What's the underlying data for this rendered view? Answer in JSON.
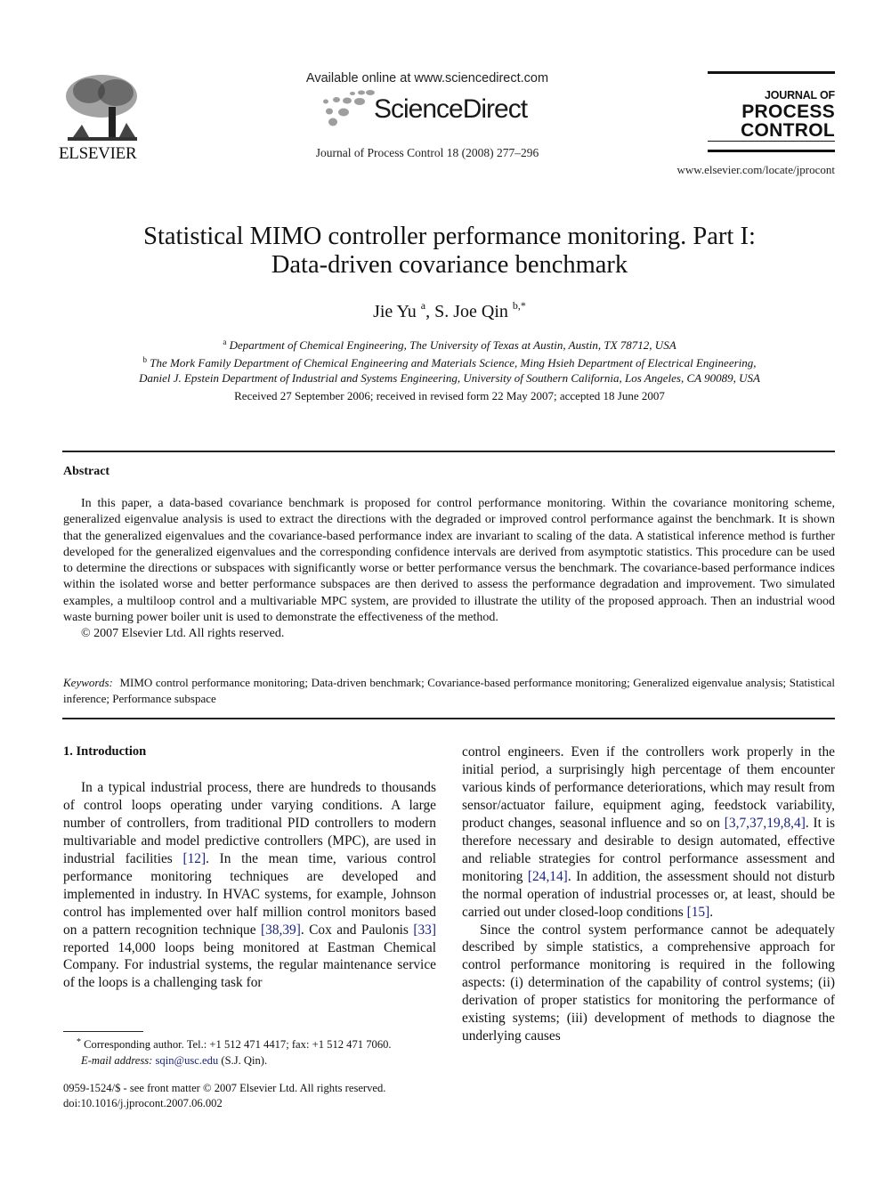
{
  "header": {
    "publisher": "ELSEVIER",
    "available_online": "Available online at www.sciencedirect.com",
    "sciencedirect_brand": "ScienceDirect",
    "journal_citation": "Journal of Process Control 18 (2008) 277–296",
    "journal_logo": {
      "line1": "JOURNAL OF",
      "line2": "PROCESS",
      "line3": "CONTROL"
    },
    "journal_url": "www.elsevier.com/locate/jprocont"
  },
  "article": {
    "title_line1": "Statistical MIMO controller performance monitoring. Part I:",
    "title_line2": "Data-driven covariance benchmark",
    "authors": [
      {
        "name": "Jie Yu",
        "sup": "a"
      },
      {
        "name": "S. Joe Qin",
        "sup": "b,*"
      }
    ],
    "author_separator": ", ",
    "affiliations": [
      {
        "sup": "a",
        "text": "Department of Chemical Engineering, The University of Texas at Austin, Austin, TX 78712, USA"
      },
      {
        "sup": "b",
        "text": "The Mork Family Department of Chemical Engineering and Materials Science, Ming Hsieh Department of Electrical Engineering,"
      },
      {
        "sup": "",
        "text": "Daniel J. Epstein Department of Industrial and Systems Engineering, University of Southern California, Los Angeles, CA 90089, USA"
      }
    ],
    "received": "Received 27 September 2006; received in revised form 22 May 2007; accepted 18 June 2007"
  },
  "abstract": {
    "heading": "Abstract",
    "text": "In this paper, a data-based covariance benchmark is proposed for control performance monitoring. Within the covariance monitoring scheme, generalized eigenvalue analysis is used to extract the directions with the degraded or improved control performance against the benchmark. It is shown that the generalized eigenvalues and the covariance-based performance index are invariant to scaling of the data. A statistical inference method is further developed for the generalized eigenvalues and the corresponding confidence intervals are derived from asymptotic statistics. This procedure can be used to determine the directions or subspaces with significantly worse or better performance versus the benchmark. The covariance-based performance indices within the isolated worse and better performance subspaces are then derived to assess the performance degradation and improvement. Two simulated examples, a multiloop control and a multivariable MPC system, are provided to illustrate the utility of the proposed approach. Then an industrial wood waste burning power boiler unit is used to demonstrate the effectiveness of the method.",
    "copyright": "© 2007 Elsevier Ltd. All rights reserved."
  },
  "keywords": {
    "label": "Keywords:",
    "text": "MIMO control performance monitoring; Data-driven benchmark; Covariance-based performance monitoring; Generalized eigenvalue analysis; Statistical inference; Performance subspace"
  },
  "introduction": {
    "heading": "1. Introduction",
    "left_col": {
      "p1_a": "In a typical industrial process, there are hundreds to thousands of control loops operating under varying conditions. A large number of controllers, from traditional PID controllers to modern multivariable and model predictive controllers (MPC), are used in industrial facilities ",
      "ref1": "[12]",
      "p1_b": ". In the mean time, various control performance monitoring techniques are developed and implemented in industry. In HVAC systems, for example, Johnson control has implemented over half million control monitors based on a pattern recognition technique ",
      "ref2": "[38,39]",
      "p1_c": ". Cox and Paulonis ",
      "ref3": "[33]",
      "p1_d": " reported 14,000 loops being monitored at Eastman Chemical Company. For industrial systems, the regular maintenance service of the loops is a challenging task for"
    },
    "right_col": {
      "p1_a": "control engineers. Even if the controllers work properly in the initial period, a surprisingly high percentage of them encounter various kinds of performance deteriorations, which may result from sensor/actuator failure, equipment aging, feedstock variability, product changes, seasonal influence and so on ",
      "ref1": "[3,7,37,19,8,4]",
      "p1_b": ". It is therefore necessary and desirable to design automated, effective and reliable strategies for control performance assessment and monitoring ",
      "ref2": "[24,14]",
      "p1_c": ". In addition, the assessment should not disturb the normal operation of industrial processes or, at least, should be carried out under closed-loop conditions ",
      "ref3": "[15]",
      "p1_d": ".",
      "p2": "Since the control system performance cannot be adequately described by simple statistics, a comprehensive approach for control performance monitoring is required in the following aspects: (i) determination of the capability of control systems; (ii) derivation of proper statistics for monitoring the performance of existing systems; (iii) development of methods to diagnose the underlying causes"
    }
  },
  "footnote": {
    "marker": "*",
    "corresponding": "Corresponding author. Tel.: +1 512 471 4417; fax: +1 512 471 7060.",
    "email_label": "E-mail address:",
    "email": "sqin@usc.edu",
    "email_owner": "(S.J. Qin)."
  },
  "front_matter": {
    "issn_line": "0959-1524/$ - see front matter © 2007 Elsevier Ltd. All rights reserved.",
    "doi": "doi:10.1016/j.jprocont.2007.06.002"
  },
  "colors": {
    "text": "#111111",
    "link": "#1a237e",
    "sd_dots": "#9e9e9e"
  }
}
